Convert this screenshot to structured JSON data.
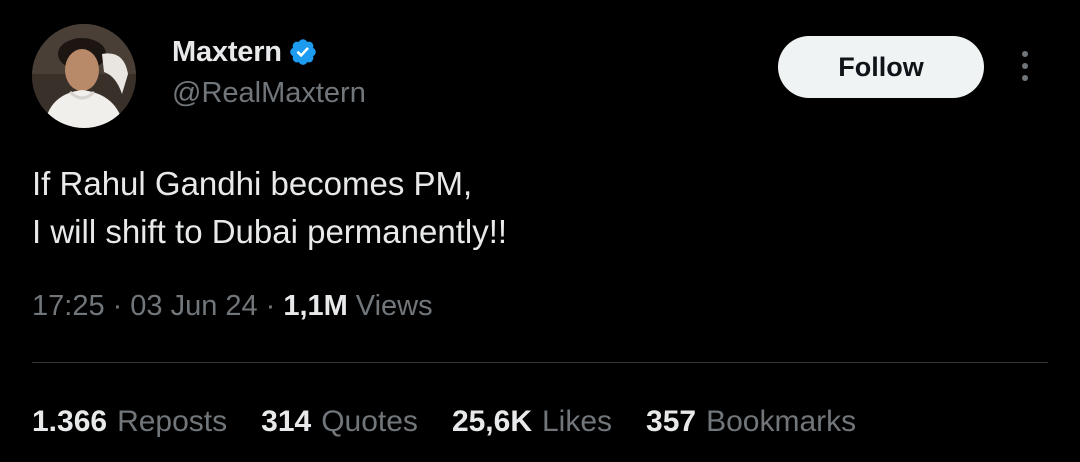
{
  "author": {
    "display_name": "Maxtern",
    "handle": "@RealMaxtern",
    "verified": true,
    "verified_icon": "verified-badge-icon",
    "verified_color": "#1d9bf0"
  },
  "header": {
    "follow_label": "Follow",
    "more_icon": "more-vertical-icon"
  },
  "tweet": {
    "lines": [
      "If Rahul Gandhi becomes PM,",
      "I will shift to Dubai permanently!!"
    ]
  },
  "meta": {
    "time": "17:25",
    "separator": "·",
    "date": "03 Jun 24",
    "views_count": "1,1M",
    "views_label": "Views"
  },
  "stats": {
    "reposts": {
      "count": "1.366",
      "label": "Reposts"
    },
    "quotes": {
      "count": "314",
      "label": "Quotes"
    },
    "likes": {
      "count": "25,6K",
      "label": "Likes"
    },
    "bookmarks": {
      "count": "357",
      "label": "Bookmarks"
    }
  },
  "colors": {
    "background": "#000000",
    "primary_text": "#e7e9ea",
    "secondary_text": "#71767b",
    "divider": "#2f3336",
    "follow_bg": "#eff3f4"
  }
}
